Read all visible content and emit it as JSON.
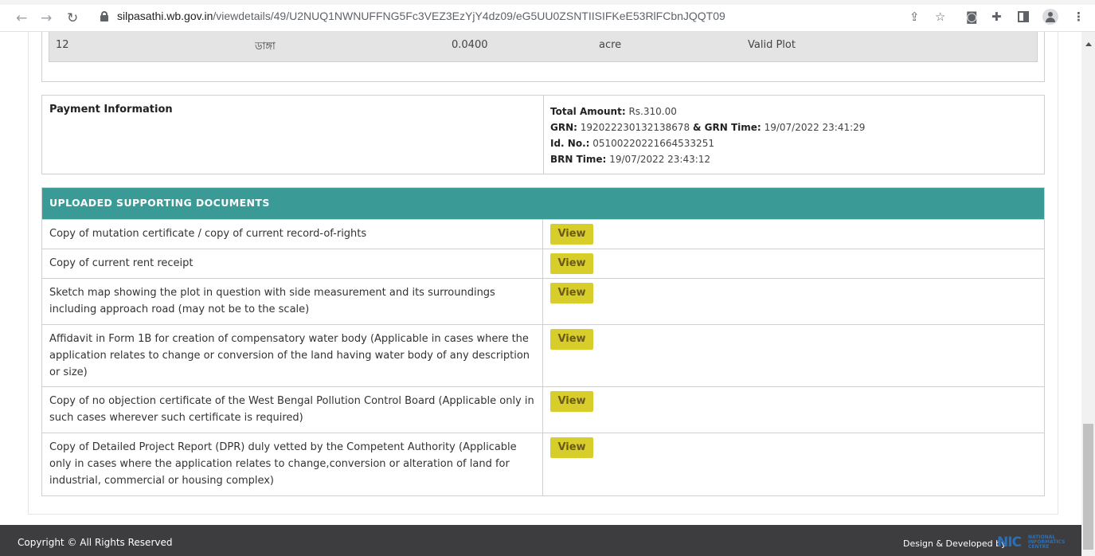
{
  "browser": {
    "url_domain": "silpasathi.wb.gov.in",
    "url_path": "/viewdetails/49/U2NUQ1NWNUFFNG5Fc3VEZ3EzYjY4dz09/eG5UU0ZSNTIISIFKeE53RlFCbnJQQT09",
    "icons": [
      "back-arrow",
      "forward-arrow",
      "reload",
      "lock",
      "share",
      "star",
      "camera",
      "extensions",
      "side-panel",
      "profile",
      "menu"
    ]
  },
  "plot_row": {
    "plot_no": "12",
    "land_type": "ডাঙ্গা",
    "area": "0.0400",
    "unit": "acre",
    "status": "Valid Plot"
  },
  "payment": {
    "title": "Payment Information",
    "total_label": "Total Amount:",
    "total_value": "Rs.310.00",
    "grn_label": "GRN:",
    "grn_value": "192022230132138678",
    "grn_time_label": "& GRN Time:",
    "grn_time_value": "19/07/2022 23:41:29",
    "id_label": "Id. No.:",
    "id_value": "05100220221664533251",
    "brn_label": "BRN Time:",
    "brn_value": "19/07/2022 23:43:12"
  },
  "documents": {
    "header": "UPLOADED SUPPORTING DOCUMENTS",
    "view_label": "View",
    "items": [
      "Copy of mutation certificate / copy of current record-of-rights",
      "Copy of current rent receipt",
      "Sketch map showing the plot in question with side measurement and its surroundings including approach road (may not be to the scale)",
      "Affidavit in Form 1B for creation of compensatory water body (Applicable in cases where the application relates to change or conversion of the land having water body of any description or size)",
      "Copy of no objection certificate of the West Bengal Pollution Control Board (Applicable only in such cases wherever such certificate is required)",
      "Copy of Detailed Project Report (DPR) duly vetted by the Competent Authority (Applicable only in cases where the application relates to change,conversion or alteration of land for industrial, commercial or housing complex)"
    ]
  },
  "footer": {
    "copyright": "Copyright © All Rights Reserved",
    "design": "Design & Developed by",
    "logo_big": "NIC",
    "logo_small": [
      "NATIONAL",
      "INFORMATICS",
      "CENTRE"
    ]
  },
  "colors": {
    "header_teal": "#3a9a96",
    "view_button": "#d7ce2c",
    "footer_bg": "#3d3d3f"
  }
}
